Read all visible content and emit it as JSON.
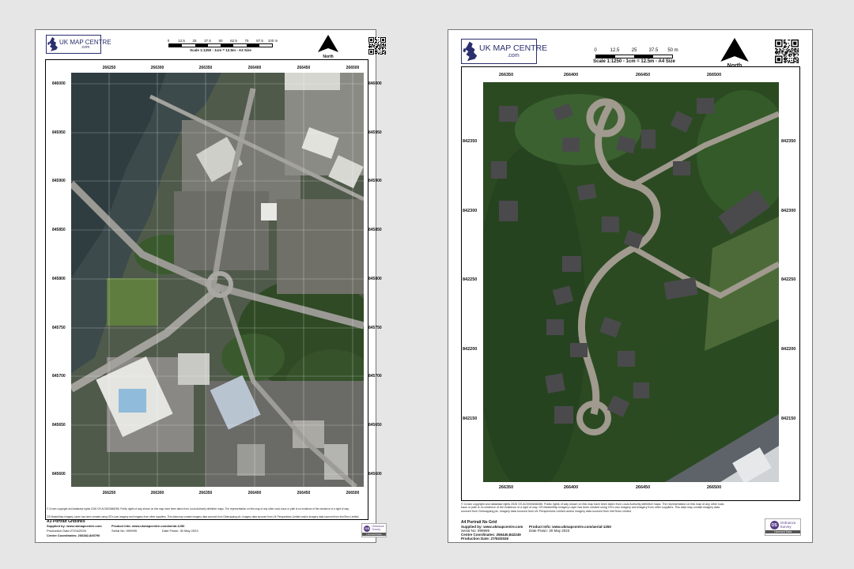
{
  "sheets": [
    {
      "logo": {
        "line1": "UK MAP CENTRE",
        "line2": ".com"
      },
      "scale": {
        "ticks": [
          "0",
          "12.5",
          "25",
          "37.5",
          "50",
          "62.5",
          "75",
          "87.5",
          "100 m"
        ],
        "text": "Scale 1:1250 - 1cm = 12.5m - A3 Size"
      },
      "north_label": "North",
      "top_eastings": [
        "266250",
        "266300",
        "266350",
        "266400",
        "266450",
        "266500"
      ],
      "bottom_eastings": [
        "266250",
        "266300",
        "266350",
        "266400",
        "266450",
        "266500"
      ],
      "left_northings": [
        "846000",
        "845950",
        "845900",
        "845850",
        "845800",
        "845750",
        "845700",
        "845650",
        "845600"
      ],
      "right_northings": [
        "846000",
        "845950",
        "845900",
        "845850",
        "845800",
        "845750",
        "845700",
        "845650",
        "845600"
      ],
      "footer": {
        "copyright": "© Crown copyright and database rights 2026 OS AC0000848285. Public rights of way shown on this map have been taken from Local Authority definitive maps. The representation on this map of any other road, track or path is no evidence of the existence of a right of way.",
        "copyright2": "OS MasterMap Imagery Layer has been created using OS's own imagery and imagery from other suppliers. This data may contain imagery data sourced from Getmapping plc, imagery data sourced from UK Perspectives Limited and/or imagery data sourced from InfoTerra Limited.",
        "product_name": "A3 Portrait Gridlines",
        "supplied_by": "Supplied by: www.ukmapcentre.com",
        "product_info": "Product Info: www.ukmapcentre.com/aerial-1250",
        "production_date": "Production Date:27/04/2026",
        "serial": "Serial No: 999999",
        "date_flown": "Date Flown: 30 May 2023",
        "centre": "Centre Coordinates: 266382,845790"
      },
      "os_logo": {
        "name1": "Ordnance",
        "name2": "Survey",
        "licensed": "Licensed Data"
      }
    },
    {
      "logo": {
        "line1": "UK MAP CENTRE",
        "line2": ".com"
      },
      "scale": {
        "ticks": [
          "0",
          "12.5",
          "25",
          "37.5",
          "50 m"
        ],
        "text": "Scale 1:1250 - 1cm = 12.5m - A4 Size"
      },
      "north_label": "North",
      "top_eastings": [
        "266350",
        "266400",
        "266450",
        "266500"
      ],
      "bottom_eastings": [
        "266350",
        "266400",
        "266450",
        "266500"
      ],
      "left_northings": [
        "842350",
        "842300",
        "842250",
        "842200",
        "842150"
      ],
      "right_northings": [
        "842350",
        "842300",
        "842250",
        "842200",
        "842150"
      ],
      "footer": {
        "copyright": "© Crown copyright and database rights 2026 OS AC0000848285. Public rights of way shown on this map have been taken from Local Authority definitive maps. The representation on this map of any other road, track or path is no evidence of the existence of a right of way. OS MasterMap Imagery Layer has been created using OS's own imagery and imagery from other suppliers. This data may contain imagery data sourced from Getmapping plc, imagery data sourced from UK Perspectives Limited and/or imagery data sourced from InfoTerra Limited.",
        "product_name": "A4 Portrait No Grid",
        "supplied_by": "Supplied by: www.ukmapcentre.com",
        "product_info": "Product Info: www.ukmapcentre.com/aerial-1250",
        "serial": "Serial No: 999999",
        "date_flown": "Date Flown: 30 May 2023",
        "centre": "Centre Coordinates: 266440,842249",
        "production_date": "Production Date: 27/04/2026"
      },
      "os_logo": {
        "name1": "Ordnance",
        "name2": "Survey",
        "licensed": "Licensed Data"
      }
    }
  ]
}
